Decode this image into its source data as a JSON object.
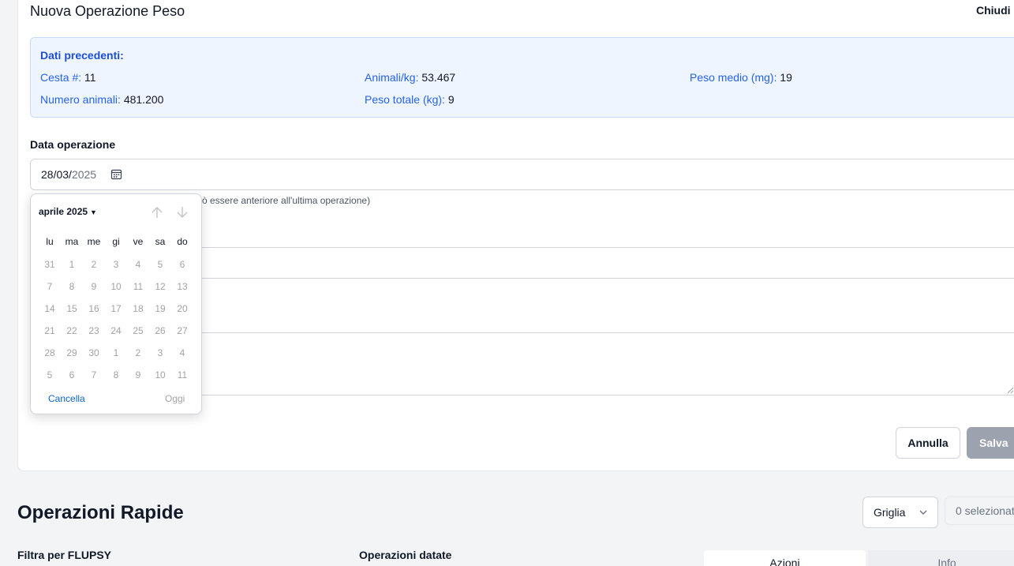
{
  "form": {
    "title": "Nuova Operazione Peso",
    "close_label": "Chiudi",
    "previous": {
      "title": "Dati precedenti:",
      "items": [
        {
          "label": "Cesta #:",
          "value": "11"
        },
        {
          "label": "Animali/kg:",
          "value": "53.467"
        },
        {
          "label": "Peso medio (mg):",
          "value": "19"
        },
        {
          "label": "Numero animali:",
          "value": "481.200"
        },
        {
          "label": "Peso totale (kg):",
          "value": "9"
        }
      ]
    },
    "date_field": {
      "label": "Data operazione",
      "day_month": "28/03/",
      "year": "2025",
      "hint": "ò essere anteriore all'ultima operazione)"
    },
    "buttons": {
      "cancel": "Annulla",
      "save": "Salva"
    }
  },
  "calendar": {
    "month_label": "aprile 2025",
    "weekdays": [
      "lu",
      "ma",
      "me",
      "gi",
      "ve",
      "sa",
      "do"
    ],
    "weeks": [
      [
        "31",
        "1",
        "2",
        "3",
        "4",
        "5",
        "6"
      ],
      [
        "7",
        "8",
        "9",
        "10",
        "11",
        "12",
        "13"
      ],
      [
        "14",
        "15",
        "16",
        "17",
        "18",
        "19",
        "20"
      ],
      [
        "21",
        "22",
        "23",
        "24",
        "25",
        "26",
        "27"
      ],
      [
        "28",
        "29",
        "30",
        "1",
        "2",
        "3",
        "4"
      ],
      [
        "5",
        "6",
        "7",
        "8",
        "9",
        "10",
        "11"
      ]
    ],
    "clear_label": "Cancella",
    "today_label": "Oggi"
  },
  "quick_ops": {
    "title": "Operazioni Rapide",
    "view_select": "Griglia",
    "selected_count": "0 selezionat",
    "filter_flupsy_label": "Filtra per FLUPSY",
    "dated_ops_label": "Operazioni datate",
    "tabs": [
      "Azioni",
      "Info"
    ]
  },
  "colors": {
    "accent_blue": "#2563eb",
    "info_box_bg": "#eef5ff",
    "save_disabled": "#9ca3af",
    "link_blue": "#0b63c5"
  }
}
